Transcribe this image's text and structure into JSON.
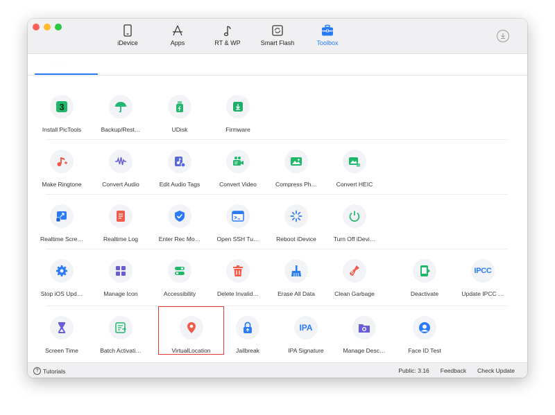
{
  "nav": {
    "tabs": [
      {
        "label": "iDevice",
        "icon": "phone-icon"
      },
      {
        "label": "Apps",
        "icon": "appstore-icon"
      },
      {
        "label": "RT & WP",
        "icon": "music-note-icon"
      },
      {
        "label": "Smart Flash",
        "icon": "flash-refresh-icon"
      },
      {
        "label": "Toolbox",
        "icon": "toolbox-icon",
        "active": true
      }
    ]
  },
  "colors": {
    "accent": "#2a7bf6",
    "selection_border": "#e53935"
  },
  "tools": {
    "row1": [
      {
        "label": "Install PicTools",
        "icon": "pictools-3-icon",
        "color": "#1fb86a"
      },
      {
        "label": "Backup/Rest…",
        "icon": "umbrella-icon",
        "color": "#22b573"
      },
      {
        "label": "UDisk",
        "icon": "flash-drive-icon",
        "color": "#23b66d"
      },
      {
        "label": "Firmware",
        "icon": "firmware-download-icon",
        "color": "#1fae67"
      }
    ],
    "row2": [
      {
        "label": "Make Ringtone",
        "icon": "ringtone-icon",
        "color": "#f25a4a"
      },
      {
        "label": "Convert Audio",
        "icon": "waveform-icon",
        "color": "#6b5bd6"
      },
      {
        "label": "Edit Audio Tags",
        "icon": "audio-tag-icon",
        "color": "#5b6ad8"
      },
      {
        "label": "Convert Video",
        "icon": "video-camera-icon",
        "color": "#1fb86a"
      },
      {
        "label": "Compress Ph…",
        "icon": "image-compress-icon",
        "color": "#1fb86a"
      },
      {
        "label": "Convert HEIC",
        "icon": "heic-image-icon",
        "color": "#1fb86a"
      }
    ],
    "row3": [
      {
        "label": "Realtime Scre…",
        "icon": "screen-mirror-icon",
        "color": "#2a7bf6"
      },
      {
        "label": "Realtime Log",
        "icon": "log-document-icon",
        "color": "#f25a4a"
      },
      {
        "label": "Enter Rec Mo…",
        "icon": "shield-check-icon",
        "color": "#2a7bf6"
      },
      {
        "label": "Open SSH Tu…",
        "icon": "terminal-icon",
        "color": "#2a7bf6"
      },
      {
        "label": "Reboot iDevice",
        "icon": "spinner-icon",
        "color": "#2a7bf6"
      },
      {
        "label": "Turn Off iDevi…",
        "icon": "power-icon",
        "color": "#1fb86a"
      }
    ],
    "row4": [
      {
        "label": "Stop iOS Upd…",
        "icon": "gear-icon",
        "color": "#2a7bf6"
      },
      {
        "label": "Manage Icon",
        "icon": "grid-apps-icon",
        "color": "#6b5bd6"
      },
      {
        "label": "Accessibility",
        "icon": "toggle-icon",
        "color": "#1fb86a"
      },
      {
        "label": "Delete Invalid…",
        "icon": "trash-icon",
        "color": "#f25a4a"
      },
      {
        "label": "Erase All Data",
        "icon": "broom-icon",
        "color": "#2a7bf6"
      },
      {
        "label": "Clean Garbage",
        "icon": "clean-brush-icon",
        "color": "#f25a4a"
      },
      {
        "label": "Deactivate",
        "icon": "deactivate-phone-icon",
        "color": "#1fb86a"
      },
      {
        "label": "Update IPCC …",
        "icon": "ipcc-icon",
        "text": "IPCC",
        "color": "#2a7bf6"
      }
    ],
    "row5": [
      {
        "label": "Screen Time",
        "icon": "hourglass-icon",
        "color": "#6b5bd6"
      },
      {
        "label": "Batch Activati…",
        "icon": "batch-activate-icon",
        "color": "#1fb86a"
      },
      {
        "label": "VirtualLocation",
        "icon": "location-pin-icon",
        "color": "#f25a4a",
        "selected": true
      },
      {
        "label": "Jailbreak",
        "icon": "unlock-icon",
        "color": "#2a7bf6"
      },
      {
        "label": "IPA Signature",
        "icon": "ipa-icon",
        "text": "IPA",
        "color": "#2a7bf6"
      },
      {
        "label": "Manage Desc…",
        "icon": "settings-folder-icon",
        "color": "#6b5bd6"
      },
      {
        "label": "Face ID Test",
        "icon": "face-id-icon",
        "color": "#2a7bf6"
      }
    ]
  },
  "status": {
    "tutorials": "Tutorials",
    "version": "Public: 3.16",
    "feedback": "Feedback",
    "check_update": "Check Update"
  }
}
